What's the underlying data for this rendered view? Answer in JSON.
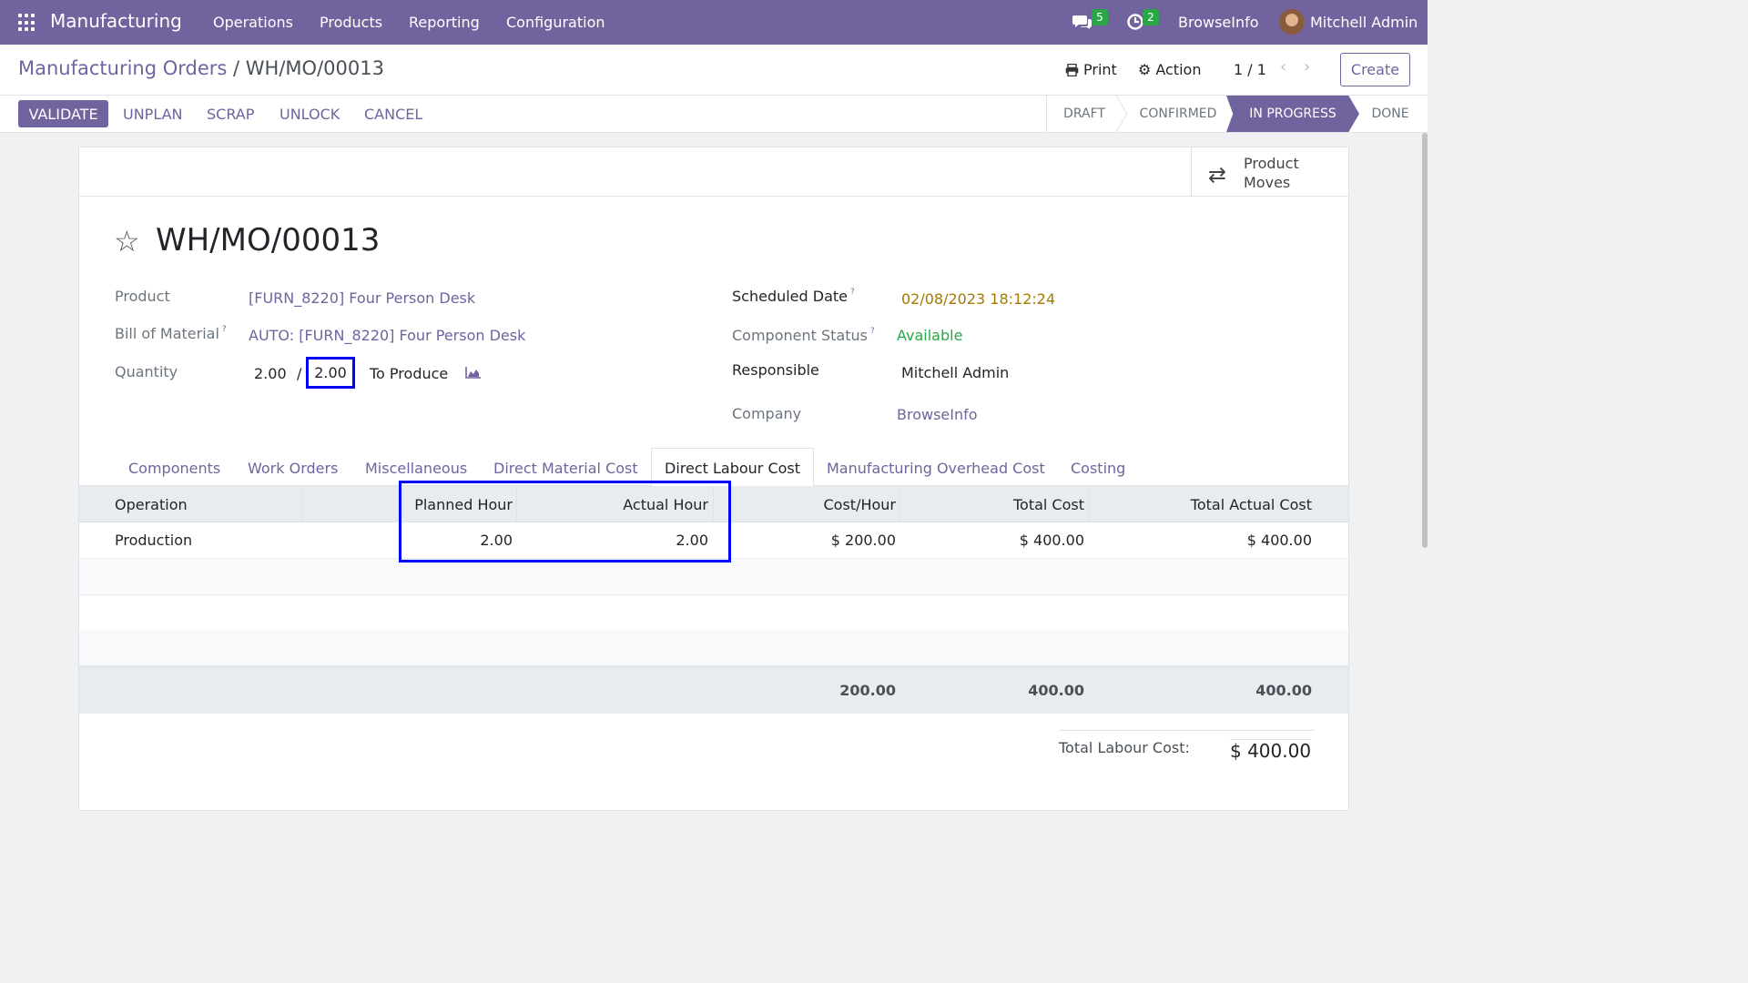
{
  "navbar": {
    "app_name": "Manufacturing",
    "menus": [
      "Operations",
      "Products",
      "Reporting",
      "Configuration"
    ],
    "messages_count": "5",
    "activities_count": "2",
    "company": "BrowseInfo",
    "user": "Mitchell Admin"
  },
  "control_panel": {
    "breadcrumb_parent": "Manufacturing Orders",
    "breadcrumb_sep": " / ",
    "breadcrumb_current": "WH/MO/00013",
    "print_label": "Print",
    "action_label": "Action",
    "pager": "1 / 1",
    "create_label": "Create"
  },
  "statusbar": {
    "buttons": [
      "VALIDATE",
      "UNPLAN",
      "SCRAP",
      "UNLOCK",
      "CANCEL"
    ],
    "stages": [
      "DRAFT",
      "CONFIRMED",
      "IN PROGRESS",
      "DONE"
    ],
    "active_stage": "IN PROGRESS"
  },
  "smart_button": {
    "label_line1": "Product",
    "label_line2": "Moves"
  },
  "record": {
    "name": "WH/MO/00013",
    "product_label": "Product",
    "product": "[FURN_8220] Four Person Desk",
    "bom_label": "Bill of Material",
    "bom": "AUTO: [FURN_8220] Four Person Desk",
    "quantity_label": "Quantity",
    "qty_produced": "2.00",
    "qty_sep": "/",
    "qty_total": "2.00",
    "to_produce": "To Produce",
    "scheduled_label": "Scheduled Date",
    "scheduled": "02/08/2023 18:12:24",
    "component_label": "Component Status",
    "component_status": "Available",
    "responsible_label": "Responsible",
    "responsible": "Mitchell Admin",
    "company_label": "Company",
    "company": "BrowseInfo",
    "help_mark": "?"
  },
  "tabs": [
    "Components",
    "Work Orders",
    "Miscellaneous",
    "Direct Material Cost",
    "Direct Labour Cost",
    "Manufacturing Overhead Cost",
    "Costing"
  ],
  "active_tab": "Direct Labour Cost",
  "table": {
    "headers": [
      "Operation",
      "Planned Hour",
      "Actual Hour",
      "Cost/Hour",
      "Total Cost",
      "Total Actual Cost"
    ],
    "rows": [
      {
        "operation": "Production",
        "planned": "2.00",
        "actual": "2.00",
        "cost_hour": "$ 200.00",
        "total": "$ 400.00",
        "total_actual": "$ 400.00"
      }
    ],
    "footer": {
      "cost_hour": "200.00",
      "total": "400.00",
      "total_actual": "400.00"
    }
  },
  "summary": {
    "label": "Total Labour Cost:",
    "value": "$ 400.00"
  },
  "colors": {
    "brand": "#71639e",
    "highlight": "#0000ff",
    "success": "#28a745",
    "badge": "#28a745"
  }
}
